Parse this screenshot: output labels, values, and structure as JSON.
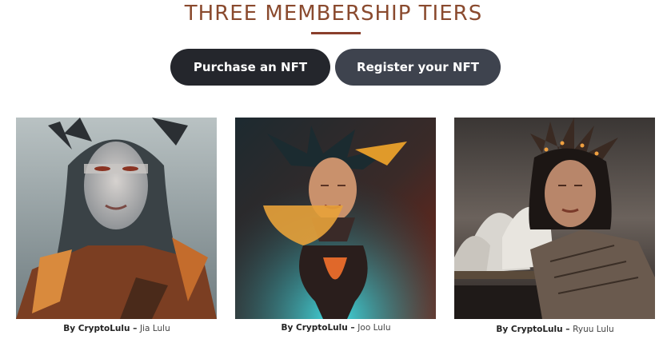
{
  "section": {
    "title": "THREE MEMBERSHIP TIERS",
    "title_color": "#8a4a2e"
  },
  "buttons": {
    "purchase_label": "Purchase an NFT",
    "register_label": "Register your NFT"
  },
  "cards": [
    {
      "by": "By CryptoLulu",
      "dash": " – ",
      "artist": "Jia Lulu"
    },
    {
      "by": "By CryptoLulu",
      "dash": " – ",
      "artist": "Joo Lulu"
    },
    {
      "by": "By CryptoLulu",
      "dash": " – ",
      "artist": "Ryuu Lulu"
    }
  ]
}
